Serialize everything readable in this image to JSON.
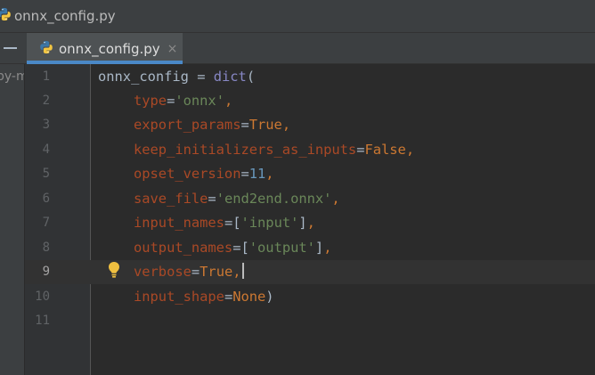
{
  "window": {
    "title": "onnx_config.py",
    "file_icon": "python-file-icon"
  },
  "tabs": [
    {
      "label": "onnx_config.py",
      "icon": "python-file-icon",
      "close": "×",
      "active": true
    }
  ],
  "project_panel": {
    "clipped_text": "py-m"
  },
  "editor": {
    "current_line": 9,
    "lines": [
      {
        "number": "1"
      },
      {
        "number": "2"
      },
      {
        "number": "3"
      },
      {
        "number": "4"
      },
      {
        "number": "5"
      },
      {
        "number": "6"
      },
      {
        "number": "7"
      },
      {
        "number": "8"
      },
      {
        "number": "9"
      },
      {
        "number": "10"
      },
      {
        "number": "11"
      }
    ],
    "code": {
      "l1": {
        "name": "onnx_config",
        "op": " = ",
        "fn": "dict",
        "paren": "("
      },
      "l2": {
        "kw": "type",
        "eq": "=",
        "val": "'onnx'",
        "comma": ","
      },
      "l3": {
        "kw": "export_params",
        "eq": "=",
        "val": "True",
        "comma": ","
      },
      "l4": {
        "kw": "keep_initializers_as_inputs",
        "eq": "=",
        "val": "False",
        "comma": ","
      },
      "l5": {
        "kw": "opset_version",
        "eq": "=",
        "val": "11",
        "comma": ","
      },
      "l6": {
        "kw": "save_file",
        "eq": "=",
        "val": "'end2end.onnx'",
        "comma": ","
      },
      "l7": {
        "kw": "input_names",
        "eq": "=",
        "open": "[",
        "val": "'input'",
        "close": "]",
        "comma": ","
      },
      "l8": {
        "kw": "output_names",
        "eq": "=",
        "open": "[",
        "val": "'output'",
        "close": "]",
        "comma": ","
      },
      "l9": {
        "kw": "verbose",
        "eq": "=",
        "val": "True",
        "comma": ","
      },
      "l10": {
        "kw": "input_shape",
        "eq": "=",
        "val": "None",
        "paren": ")"
      }
    },
    "intention_icon": "lightbulb-icon"
  },
  "colors": {
    "background": "#2b2b2b",
    "gutter": "#313335",
    "kwarg": "#aa4926",
    "string": "#6a8759",
    "keyword": "#cc7832",
    "number": "#6897bb",
    "builtin": "#8888c6",
    "tab_accent": "#4a88c7",
    "bulb": "#f0c040"
  }
}
